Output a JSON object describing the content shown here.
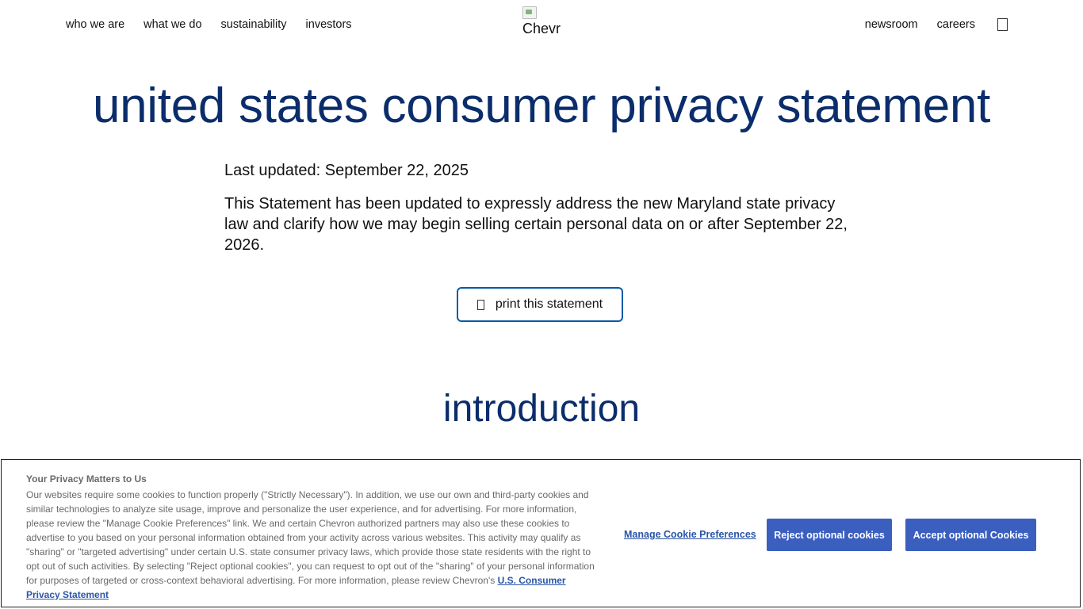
{
  "nav": {
    "left_items": [
      "who we are",
      "what we do",
      "sustainability",
      "investors"
    ],
    "logo_alt": "Chevr",
    "right_items": [
      "newsroom",
      "careers"
    ],
    "menu_icon": "menu-icon"
  },
  "page": {
    "title": "united states consumer privacy statement",
    "last_updated": "Last updated: September 22, 2025",
    "summary": "This Statement has been updated to expressly address the new Maryland state privacy law and clarify how we may begin selling certain personal data on or after September 22, 2026.",
    "print_label": "print this statement",
    "print_icon": "print-icon",
    "section_heading": "introduction"
  },
  "cookie_banner": {
    "title": "Your Privacy Matters to Us",
    "body": "Our websites require some cookies to function properly (\"Strictly Necessary\"). In addition, we use our own and third-party cookies and similar technologies to analyze site usage, improve and personalize the user experience, and for advertising. For more information, please review the \"Manage Cookie Preferences\" link. We and certain Chevron authorized partners may also use these cookies to advertise to you based on your personal information obtained from your activity across various websites. This activity may qualify as \"sharing\" or \"targeted advertising\" under certain U.S. state consumer privacy laws, which provide those state residents with the right to opt out of such activities. By selecting \"Reject optional cookies\", you can request to opt out of the \"sharing\" of your personal information for purposes of targeted or cross-context behavioral advertising. For more information, please review Chevron's ",
    "policy_link": "U.S. Consumer Privacy Statement",
    "manage_label": "Manage Cookie Preferences",
    "reject_label": "Reject optional cookies",
    "accept_label": "Accept optional Cookies",
    "colors": {
      "button": "#3a5fbf",
      "link": "#2a55a8",
      "text": "#696969"
    }
  },
  "colors": {
    "heading": "#0b2d6b",
    "button_border": "#0a5aa6"
  }
}
